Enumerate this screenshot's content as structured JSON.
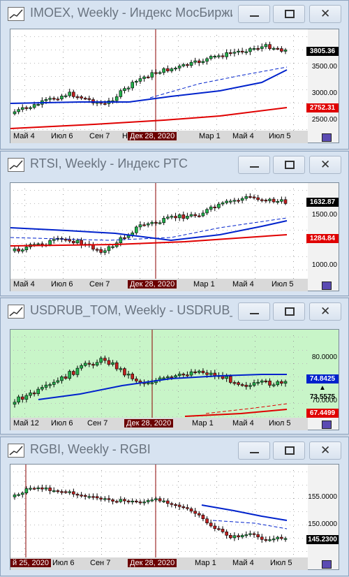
{
  "colors": {
    "up": "#22b04b",
    "down": "#c0201f",
    "ma_blue": "#0022cc",
    "ma_red": "#e00000",
    "marker": "#8b0000",
    "green_bg": "#c8f5c8"
  },
  "windows": [
    {
      "title": "IMOEX, Weekly - Индекс МосБиржи",
      "x_labels": [
        "Май 4",
        "Июл 6",
        "Сен 7",
        "Н",
        "Мар 1",
        "Май 4",
        "Июл 5"
      ],
      "highlight_date": "Дек 28, 2020",
      "y_ticks": [
        "3500.00",
        "3000.00",
        "2500.00"
      ],
      "last_price": "3805.36",
      "ma_long_value": "2752.31",
      "icons": [
        "chart-icon",
        "minimize-icon",
        "maximize-icon",
        "close-icon"
      ]
    },
    {
      "title": "RTSI, Weekly - Индекс РТС",
      "x_labels": [
        "Май 4",
        "Июл 6",
        "Сен 7",
        "Мар 1",
        "Май 4",
        "Июл 5"
      ],
      "highlight_date": "Дек 28, 2020",
      "y_ticks": [
        "1500.00",
        "1000.00"
      ],
      "last_price": "1632.87",
      "ma_long_value": "1284.84"
    },
    {
      "title": "USDRUB_TOM, Weekly - USDRUB_T...",
      "x_labels": [
        "Май 12",
        "Июл 6",
        "Сен 7",
        "Мар 1",
        "Май 4",
        "Июл 5"
      ],
      "highlight_date": "Дек 28, 2020",
      "y_ticks": [
        "80.0000",
        "70.0000"
      ],
      "ma_blue_value": "74.8425",
      "last_price": "73.5575",
      "ma_red_value": "67.4499"
    },
    {
      "title": "RGBI, Weekly - RGBI",
      "x_labels": [
        "й 25, 2020",
        "Июл 6",
        "Сен 7",
        "Мар 1",
        "Май 4",
        "Июл 5"
      ],
      "highlight_date": "Дек 28, 2020",
      "y_ticks": [
        "155.0000",
        "150.0000"
      ],
      "last_price": "145.2300"
    }
  ]
}
